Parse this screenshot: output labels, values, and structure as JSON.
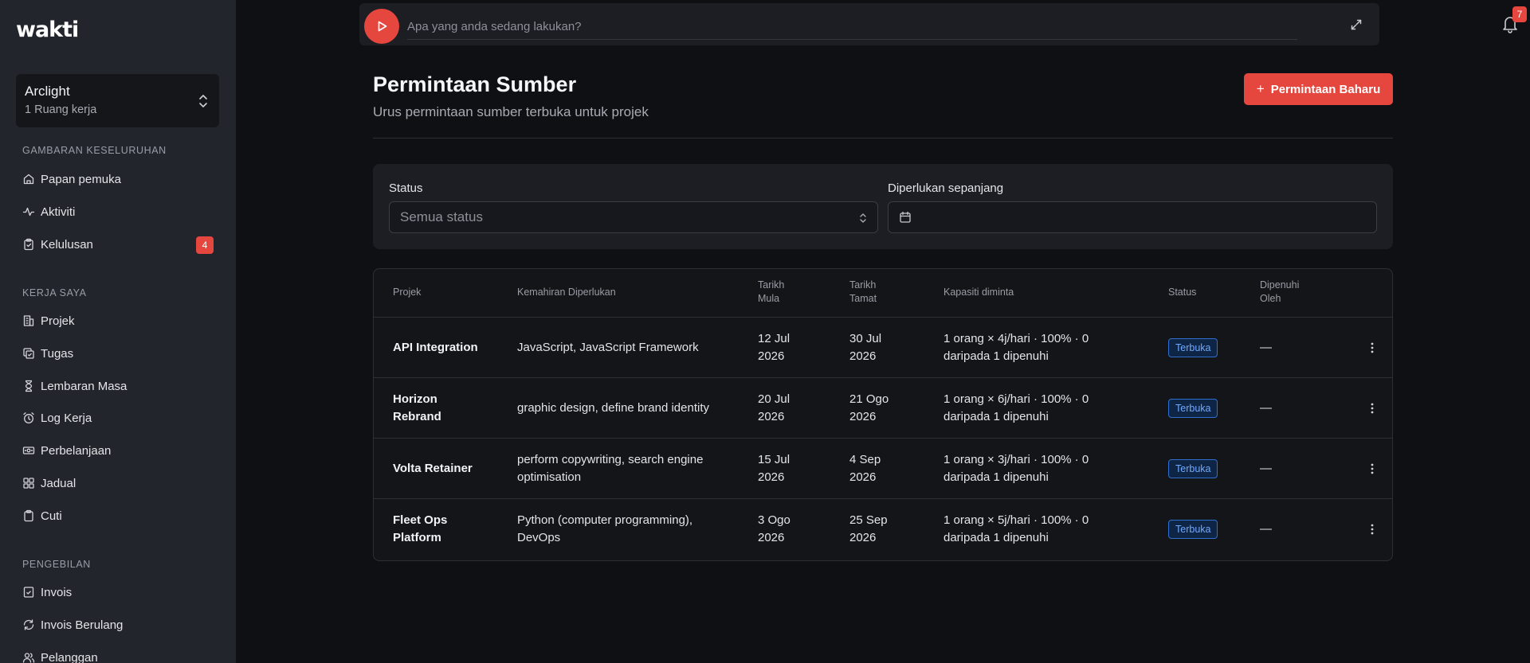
{
  "app": {
    "logo": "wakti"
  },
  "workspace": {
    "name": "Arclight",
    "sub": "1 Ruang kerja"
  },
  "sidebar": {
    "sections": [
      {
        "label": "GAMBARAN KESELURUHAN",
        "items": [
          {
            "label": "Papan pemuka",
            "icon": "home-icon"
          },
          {
            "label": "Aktiviti",
            "icon": "activity-icon"
          },
          {
            "label": "Kelulusan",
            "icon": "clipboard-check-icon",
            "badge": "4"
          }
        ]
      },
      {
        "label": "KERJA SAYA",
        "items": [
          {
            "label": "Projek",
            "icon": "building-icon"
          },
          {
            "label": "Tugas",
            "icon": "copy-check-icon"
          },
          {
            "label": "Lembaran Masa",
            "icon": "hourglass-icon"
          },
          {
            "label": "Log Kerja",
            "icon": "alarm-clock-icon"
          },
          {
            "label": "Perbelanjaan",
            "icon": "banknote-icon"
          },
          {
            "label": "Jadual",
            "icon": "grid-icon"
          },
          {
            "label": "Cuti",
            "icon": "clipboard-icon"
          }
        ]
      },
      {
        "label": "PENGEBILAN",
        "items": [
          {
            "label": "Invois",
            "icon": "file-check-icon"
          },
          {
            "label": "Invois Berulang",
            "icon": "refresh-icon"
          },
          {
            "label": "Pelanggan",
            "icon": "users-icon"
          }
        ]
      }
    ]
  },
  "timer": {
    "placeholder": "Apa yang anda sedang lakukan?"
  },
  "notifications": {
    "count": "7"
  },
  "header": {
    "title": "Permintaan Sumber",
    "subtitle": "Urus permintaan sumber terbuka untuk projek",
    "new_button": "Permintaan Baharu"
  },
  "filters": {
    "status_label": "Status",
    "status_value": "Semua status",
    "date_label": "Diperlukan sepanjang"
  },
  "table": {
    "headers": {
      "project": "Projek",
      "skills": "Kemahiran Diperlukan",
      "start_l1": "Tarikh",
      "start_l2": "Mula",
      "end_l1": "Tarikh",
      "end_l2": "Tamat",
      "capacity": "Kapasiti diminta",
      "status": "Status",
      "filled_l1": "Dipenuhi",
      "filled_l2": "Oleh"
    },
    "rows": [
      {
        "project": [
          "API Integration"
        ],
        "skills": [
          "JavaScript, JavaScript Framework"
        ],
        "start": [
          "12 Jul",
          "2026"
        ],
        "end": [
          "30 Jul",
          "2026"
        ],
        "capacity": [
          "1 orang × 4j/hari · 100% · 0",
          "daripada 1 dipenuhi"
        ],
        "status": "Terbuka",
        "filled": "—"
      },
      {
        "project": [
          "Horizon",
          "Rebrand"
        ],
        "skills": [
          "graphic design, define brand identity"
        ],
        "start": [
          "20 Jul",
          "2026"
        ],
        "end": [
          "21 Ogo",
          "2026"
        ],
        "capacity": [
          "1 orang × 6j/hari · 100% · 0",
          "daripada 1 dipenuhi"
        ],
        "status": "Terbuka",
        "filled": "—"
      },
      {
        "project": [
          "Volta Retainer"
        ],
        "skills": [
          "perform copywriting, search engine",
          "optimisation"
        ],
        "start": [
          "15 Jul",
          "2026"
        ],
        "end": [
          "4 Sep",
          "2026"
        ],
        "capacity": [
          "1 orang × 3j/hari · 100% · 0",
          "daripada 1 dipenuhi"
        ],
        "status": "Terbuka",
        "filled": "—"
      },
      {
        "project": [
          "Fleet Ops",
          "Platform"
        ],
        "skills": [
          "Python (computer programming),",
          "DevOps"
        ],
        "start": [
          "3 Ogo",
          "2026"
        ],
        "end": [
          "25 Sep",
          "2026"
        ],
        "capacity": [
          "1 orang × 5j/hari · 100% · 0",
          "daripada 1 dipenuhi"
        ],
        "status": "Terbuka",
        "filled": "—"
      }
    ]
  },
  "colors": {
    "accent": "#e5463d",
    "badge_blue": "#6fa8ff",
    "sidebar_bg": "#23252c",
    "page_bg": "#0f1014"
  }
}
